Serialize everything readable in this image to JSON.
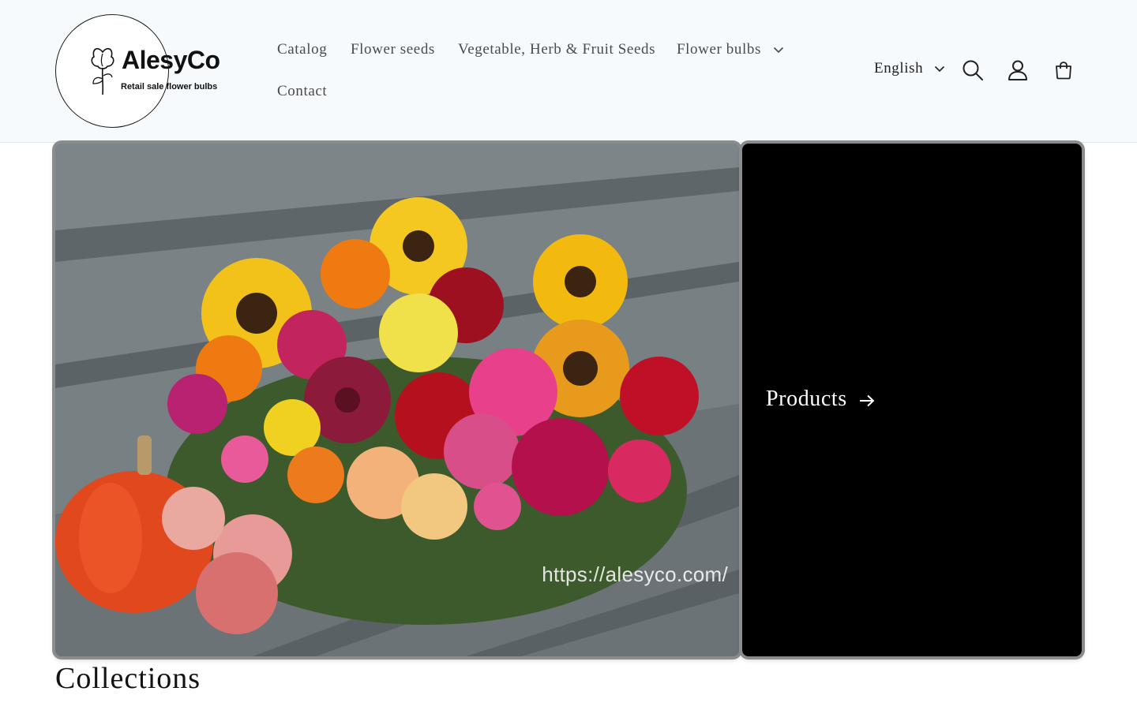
{
  "header": {
    "logo": {
      "name": "AlesyCo",
      "tagline": "Retail sale flower bulbs"
    },
    "nav": [
      {
        "label": "Catalog"
      },
      {
        "label": "Flower seeds"
      },
      {
        "label": "Vegetable, Herb & Fruit Seeds"
      },
      {
        "label": "Flower bulbs",
        "has_dropdown": true
      },
      {
        "label": "Contact"
      }
    ],
    "language": {
      "selected": "English"
    },
    "icons": [
      "search-icon",
      "account-icon",
      "cart-icon"
    ]
  },
  "hero": {
    "image_watermark": "https://alesyco.com/",
    "products_link": "Products"
  },
  "collections": {
    "title": "Collections"
  },
  "colors": {
    "header_bg": "#f6fafd",
    "products_card_bg": "#000000",
    "text": "#121212",
    "nav_text": "#4a4a4a"
  }
}
